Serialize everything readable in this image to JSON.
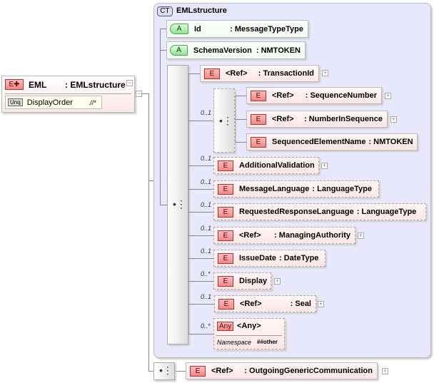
{
  "root": {
    "badge": "E",
    "name": "EML",
    "type": ": EMLstructure",
    "constraint": {
      "badge": "Unq",
      "name": "DisplayOrder",
      "selector": ".//*"
    }
  },
  "complex_type": {
    "badge": "CT",
    "name": "EMLstructure"
  },
  "attributes": [
    {
      "badge": "A",
      "name": "Id",
      "type": ": MessageTypeType"
    },
    {
      "badge": "A",
      "name": "SchemaVersion",
      "type": ": NMTOKEN"
    }
  ],
  "elements": [
    {
      "badge": "E",
      "name": "<Ref>",
      "type": ": TransactionId",
      "card": ""
    },
    {
      "badge": "E",
      "name": "<Ref>",
      "type": ": SequenceNumber",
      "card": ""
    },
    {
      "badge": "E",
      "name": "<Ref>",
      "type": ": NumberInSequence",
      "card": ""
    },
    {
      "badge": "E",
      "name": "SequencedElementName",
      "type": ": NMTOKEN",
      "card": ""
    },
    {
      "badge": "E",
      "name": "AdditionalValidation",
      "type": "",
      "card": "0..1"
    },
    {
      "badge": "E",
      "name": "MessageLanguage",
      "type": ": LanguageType",
      "card": "0..1"
    },
    {
      "badge": "E",
      "name": "RequestedResponseLanguage",
      "type": ": LanguageType",
      "card": "0..1"
    },
    {
      "badge": "E",
      "name": "<Ref>",
      "type": ": ManagingAuthority",
      "card": "0..1"
    },
    {
      "badge": "E",
      "name": "IssueDate",
      "type": ": DateType",
      "card": "0..1"
    },
    {
      "badge": "E",
      "name": "Display",
      "type": "",
      "card": "0..*"
    },
    {
      "badge": "E",
      "name": "<Ref>",
      "type": ": Seal",
      "card": "0..1"
    },
    {
      "badge": "E",
      "name": "<Ref>",
      "type": ": OutgoingGenericCommunication",
      "card": ""
    }
  ],
  "inner_sequence": {
    "card": "0..1"
  },
  "any": {
    "badge": "Any",
    "name": "<Any>",
    "card": "0..*",
    "ns_label": "Namespace",
    "ns_value": "##other"
  },
  "colors": {
    "element": "#fde6e6",
    "attribute": "#e8f8e8",
    "complex_type": "#e8e8fc"
  }
}
